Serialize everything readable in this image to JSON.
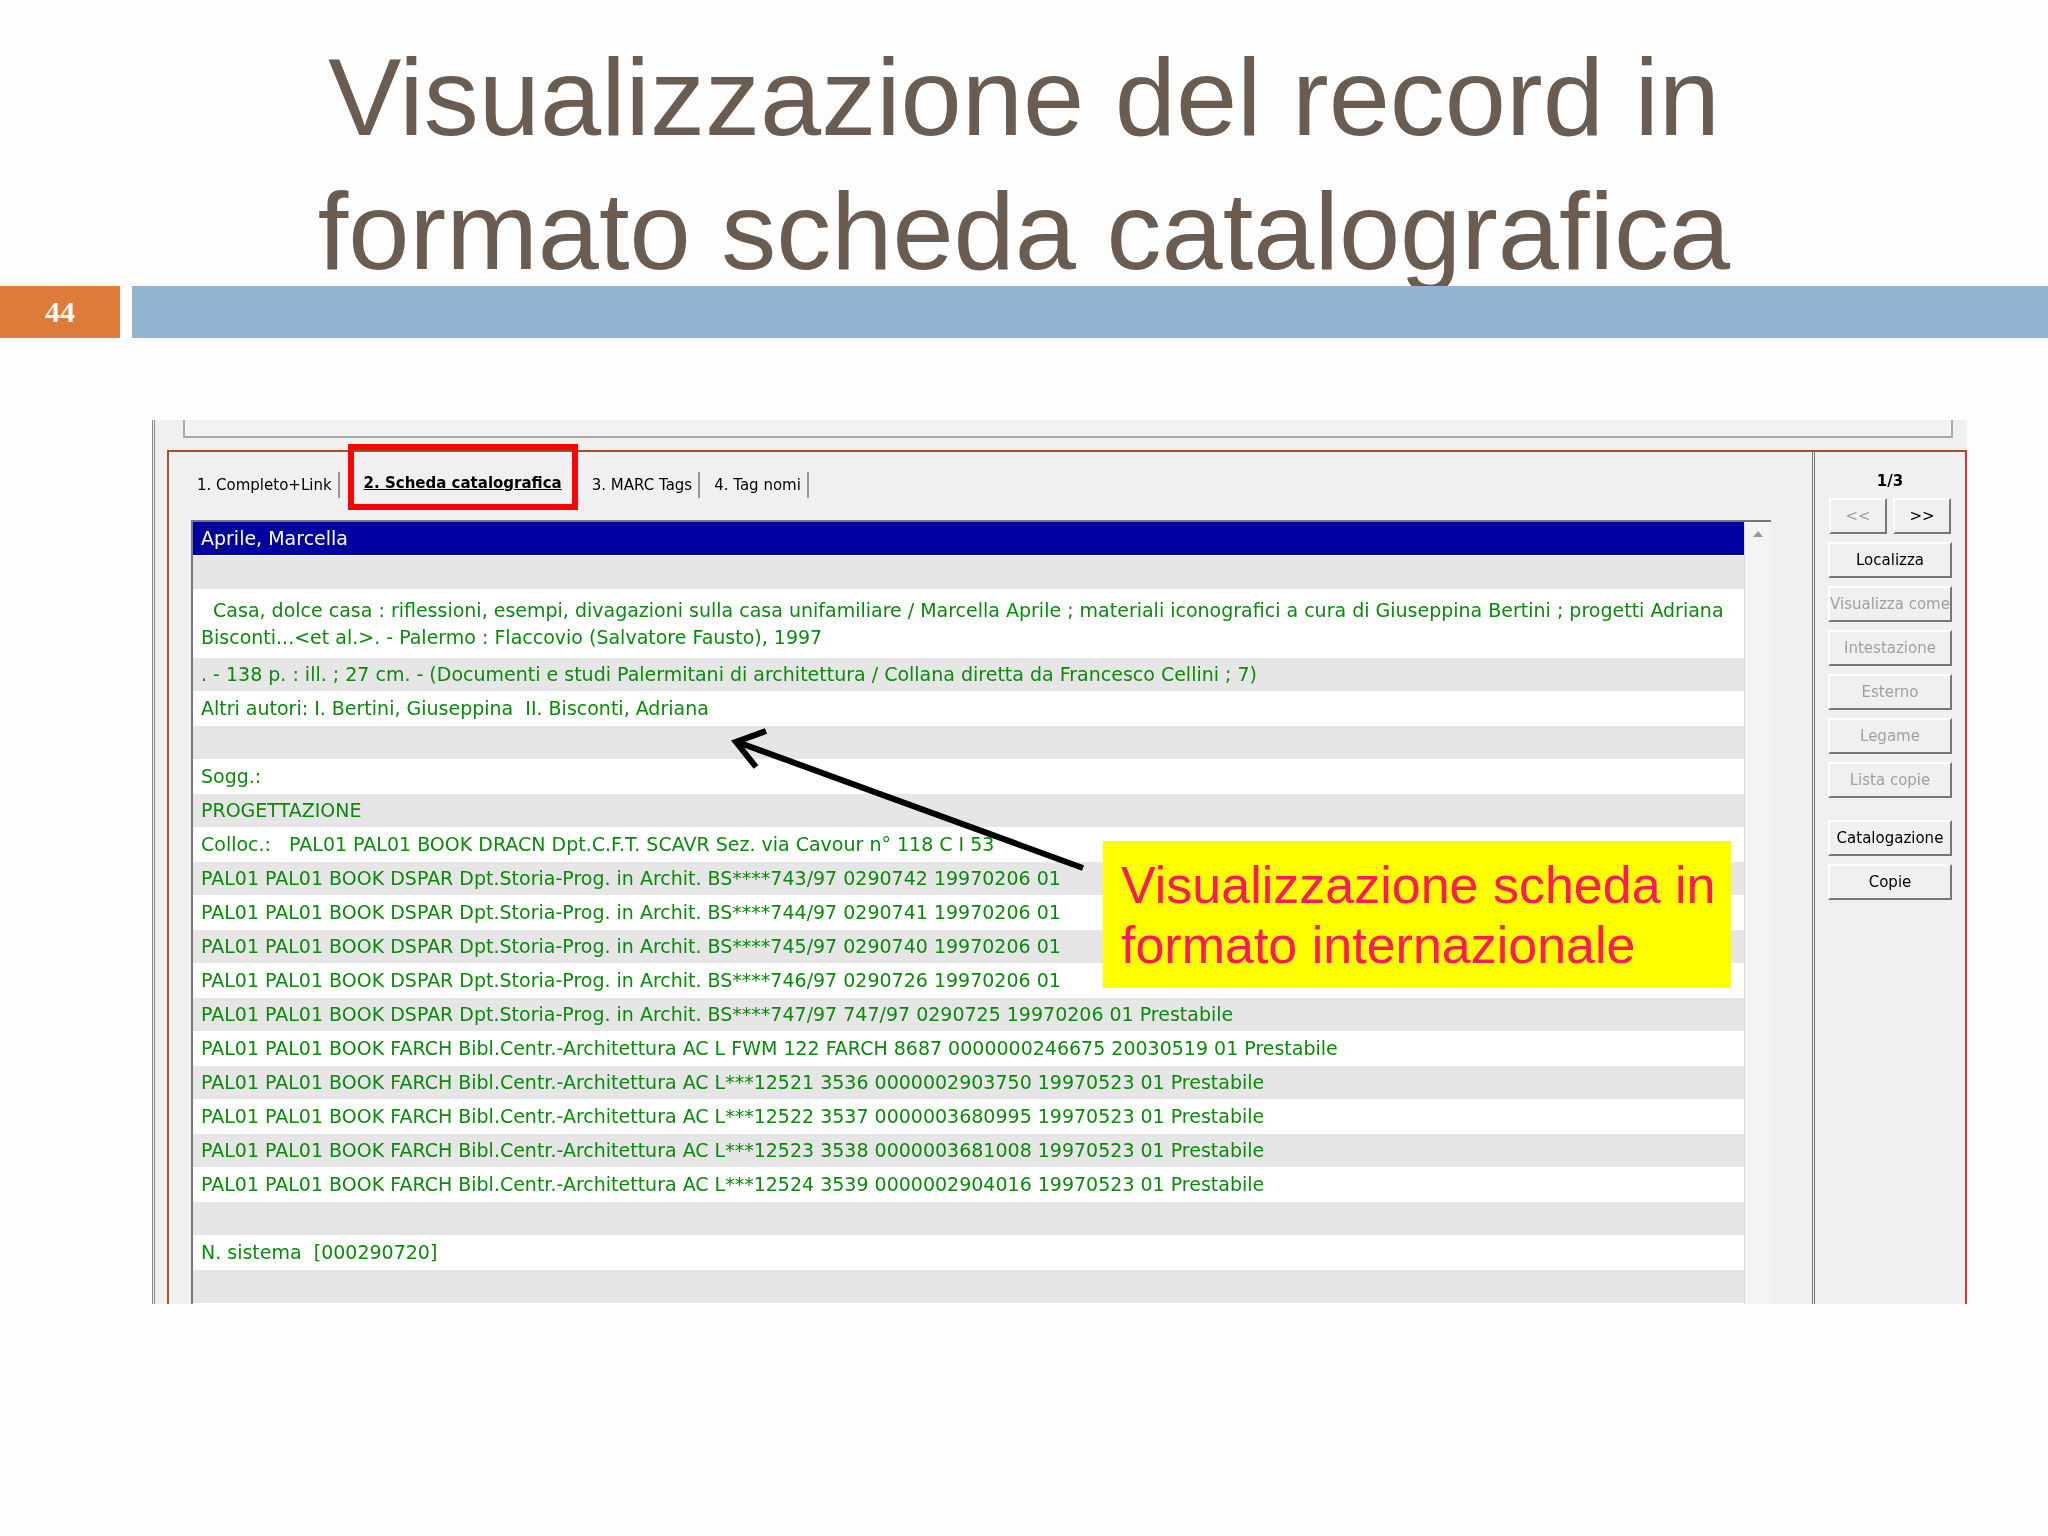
{
  "slide": {
    "title_lines": [
      "Visualizzazione del record in",
      "formato scheda catalografica"
    ],
    "page_number": "44"
  },
  "tabs": [
    {
      "label": "1. Completo+Link",
      "selected": false,
      "highlighted": false
    },
    {
      "label": "2. Scheda catalografica",
      "selected": true,
      "highlighted": true
    },
    {
      "label": "3. MARC Tags",
      "selected": false,
      "highlighted": false
    },
    {
      "label": "4. Tag nomi",
      "selected": false,
      "highlighted": false
    }
  ],
  "record_rows": [
    {
      "text": "Aprile, Marcella",
      "selected": true
    },
    {
      "text": "",
      "selected": false
    },
    {
      "text": "  Casa, dolce casa : riflessioni, esempi, divagazioni sulla casa unifamiliare / Marcella Aprile ; materiali iconografici a cura di Giuseppina Bertini ; progetti Adriana Bisconti...<et al.>. - Palermo : Flaccovio (Salvatore Fausto), 1997",
      "selected": false
    },
    {
      "text": ". - 138 p. : ill. ; 27 cm. - (Documenti e studi Palermitani di architettura / Collana diretta da Francesco Cellini ; 7)",
      "selected": false
    },
    {
      "text": "Altri autori: I. Bertini, Giuseppina  II. Bisconti, Adriana",
      "selected": false
    },
    {
      "text": "",
      "selected": false
    },
    {
      "text": "Sogg.:",
      "selected": false
    },
    {
      "text": "PROGETTAZIONE",
      "selected": false
    },
    {
      "text": "Colloc.:   PAL01 PAL01 BOOK DRACN Dpt.C.F.T. SCAVR Sez. via Cavour n° 118 C I 53",
      "selected": false
    },
    {
      "text": "PAL01 PAL01 BOOK DSPAR Dpt.Storia-Prog. in Archit. BS****743/97 0290742 19970206 01",
      "selected": false
    },
    {
      "text": "PAL01 PAL01 BOOK DSPAR Dpt.Storia-Prog. in Archit. BS****744/97 0290741 19970206 01",
      "selected": false
    },
    {
      "text": "PAL01 PAL01 BOOK DSPAR Dpt.Storia-Prog. in Archit. BS****745/97 0290740 19970206 01",
      "selected": false
    },
    {
      "text": "PAL01 PAL01 BOOK DSPAR Dpt.Storia-Prog. in Archit. BS****746/97 0290726 19970206 01",
      "selected": false
    },
    {
      "text": "PAL01 PAL01 BOOK DSPAR Dpt.Storia-Prog. in Archit. BS****747/97 747/97 0290725 19970206 01 Prestabile",
      "selected": false
    },
    {
      "text": "PAL01 PAL01 BOOK FARCH Bibl.Centr.-Architettura AC L FWM 122 FARCH 8687 0000000246675 20030519 01 Prestabile",
      "selected": false
    },
    {
      "text": "PAL01 PAL01 BOOK FARCH Bibl.Centr.-Architettura AC L***12521 3536 0000002903750 19970523 01 Prestabile",
      "selected": false
    },
    {
      "text": "PAL01 PAL01 BOOK FARCH Bibl.Centr.-Architettura AC L***12522 3537 0000003680995 19970523 01 Prestabile",
      "selected": false
    },
    {
      "text": "PAL01 PAL01 BOOK FARCH Bibl.Centr.-Architettura AC L***12523 3538 0000003681008 19970523 01 Prestabile",
      "selected": false
    },
    {
      "text": "PAL01 PAL01 BOOK FARCH Bibl.Centr.-Architettura AC L***12524 3539 0000002904016 19970523 01 Prestabile",
      "selected": false
    },
    {
      "text": "",
      "selected": false
    },
    {
      "text": "N. sistema  [000290720]",
      "selected": false
    },
    {
      "text": "",
      "selected": false
    }
  ],
  "record_counter": "1/3",
  "nav_buttons": [
    {
      "label": "<<",
      "disabled": true
    },
    {
      "label": ">>",
      "disabled": false
    }
  ],
  "side_buttons": [
    {
      "label": "Localizza",
      "disabled": false
    },
    {
      "label": "Visualizza come",
      "disabled": true
    },
    {
      "label": "Intestazione",
      "disabled": true
    },
    {
      "label": "Esterno",
      "disabled": true
    },
    {
      "label": "Legame",
      "disabled": true
    },
    {
      "label": "Lista copie",
      "disabled": true
    },
    {
      "label": "Catalogazione",
      "disabled": false
    },
    {
      "label": "Copie",
      "disabled": false
    }
  ],
  "callout": {
    "lines": [
      "Visualizzazione scheda in",
      "formato internazionale"
    ]
  }
}
